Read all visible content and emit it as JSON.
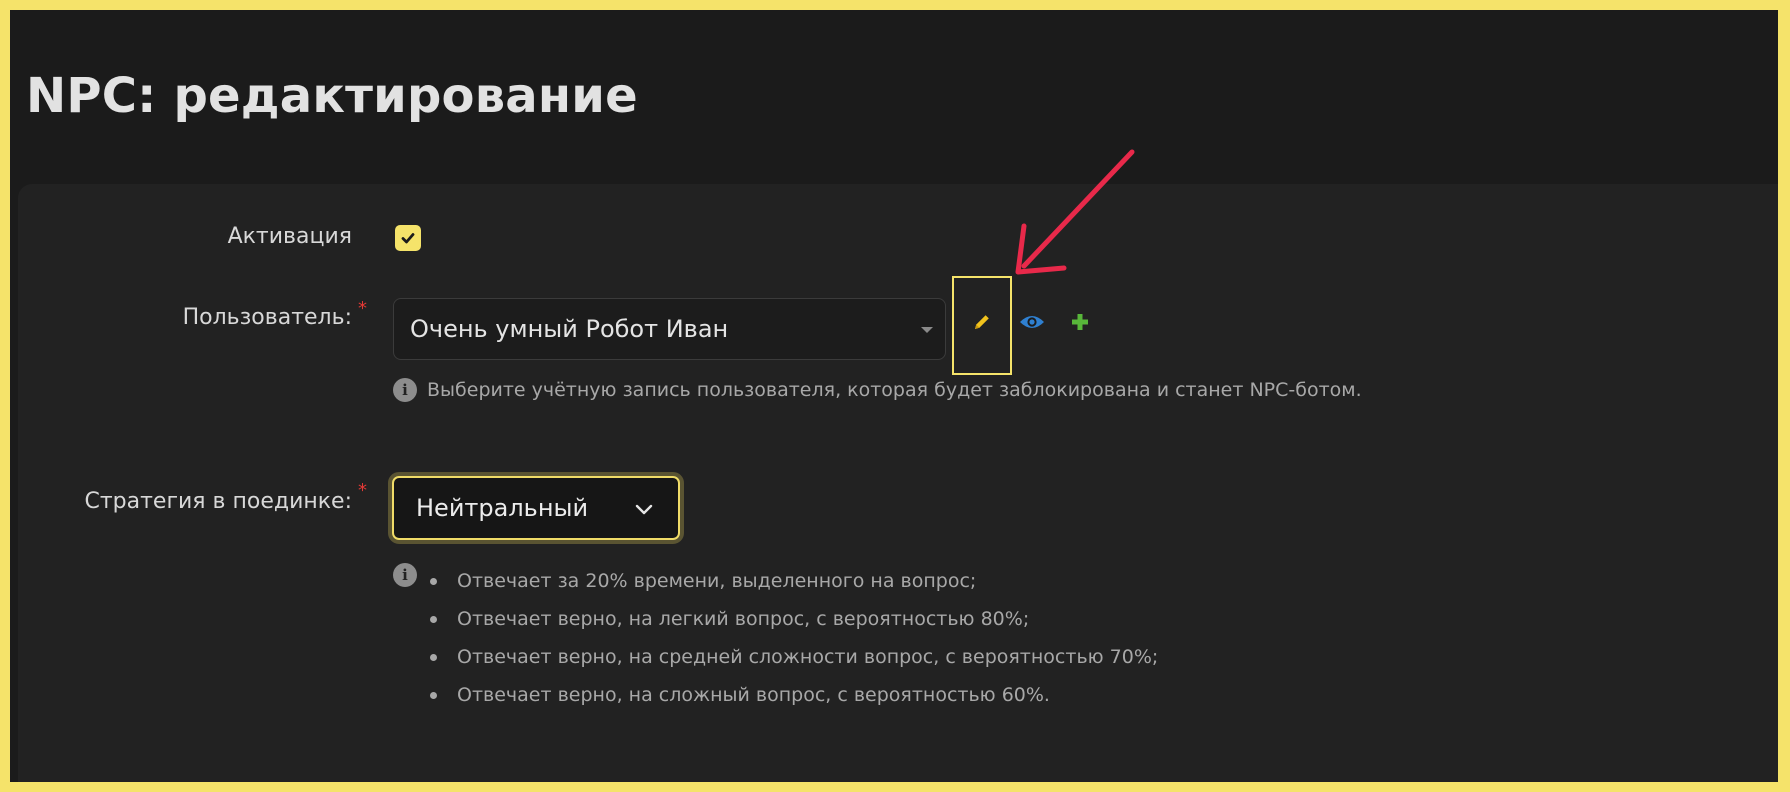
{
  "page": {
    "title": "NPC: редактирование"
  },
  "form": {
    "activation": {
      "label": "Активация",
      "checked": true
    },
    "user": {
      "label": "Пользователь:",
      "required_mark": "*",
      "selected_value": "Очень умный Робот Иван",
      "hint": "Выберите учётную запись пользователя, которая будет заблокирована и станет NPC-ботом.",
      "actions": [
        "pencil-icon",
        "eye-icon",
        "plus-icon"
      ]
    },
    "strategy": {
      "label": "Стратегия в поединке:",
      "required_mark": "*",
      "selected_value": "Нейтральный",
      "hints": [
        "Отвечает за 20% времени, выделенного на вопрос;",
        "Отвечает верно, на легкий вопрос, с вероятностью 80%;",
        "Отвечает верно, на средней сложности вопрос, с вероятностью 70%;",
        "Отвечает верно, на сложный вопрос, с вероятностью 60%."
      ]
    }
  },
  "colors": {
    "accent": "#f5e36a",
    "required": "#e53935",
    "edit_icon": "#f2c31d",
    "view_icon": "#2f80d0",
    "add_icon": "#58b73a",
    "arrow": "#e8294a",
    "background": "#1b1b1b",
    "panel": "#222222"
  }
}
